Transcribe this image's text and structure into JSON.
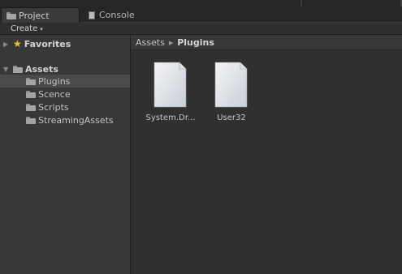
{
  "tabs": {
    "project": {
      "label": "Project",
      "icon": "folder-icon"
    },
    "console": {
      "label": "Console",
      "icon": "console-icon"
    }
  },
  "toolbar": {
    "create_label": "Create",
    "create_caret": "▾"
  },
  "tree": {
    "favorites": {
      "label": "Favorites",
      "icon": "star-icon",
      "expanded": false
    },
    "assets": {
      "label": "Assets",
      "expanded": true,
      "children": [
        {
          "label": "Plugins",
          "selected": true
        },
        {
          "label": "Scence",
          "selected": false
        },
        {
          "label": "Scripts",
          "selected": false
        },
        {
          "label": "StreamingAssets",
          "selected": false
        }
      ]
    }
  },
  "breadcrumb": {
    "root": "Assets",
    "separator": "▶",
    "current": "Plugins"
  },
  "assets_view": {
    "items": [
      {
        "label": "System.Dr...",
        "icon": "document-icon"
      },
      {
        "label": "User32",
        "icon": "document-icon"
      }
    ]
  },
  "colors": {
    "background": "#383838",
    "tab_strip": "#262626",
    "right_pane": "#303030",
    "selection": "#4a4a4a",
    "favorites_star": "#f1c12a"
  }
}
